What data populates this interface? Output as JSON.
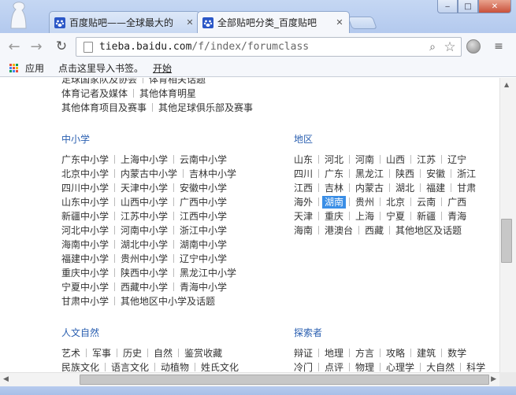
{
  "browser": {
    "tabs": [
      {
        "title": "百度贴吧——全球最大的",
        "active": false
      },
      {
        "title": "全部贴吧分类_百度贴吧",
        "active": true
      }
    ],
    "window_controls": {
      "minimize": "‒",
      "maximize": "□",
      "close": "✕"
    },
    "url": {
      "host": "tieba.baidu.com",
      "path": "/f/index/forumclass"
    },
    "bookmarks_bar": {
      "apps_label": "应用",
      "prompt": "点击这里导入书签。",
      "link": "开始"
    },
    "icons": [
      "back-arrow-icon",
      "forward-arrow-icon",
      "reload-icon",
      "page-icon",
      "search-icon",
      "star-icon",
      "globe-icon",
      "menu-icon",
      "apps-grid-icon",
      "paw-favicon"
    ],
    "colors": {
      "frame": "#b9cdef",
      "link_heading": "#2a5fb0",
      "highlight": "#3a8ee6"
    }
  },
  "content": {
    "top_rows": [
      [
        "足球国家队及协会",
        "体育相关话题"
      ],
      [
        "体育记者及媒体",
        "其他体育明星"
      ],
      [
        "其他体育项目及赛事",
        "其他足球俱乐部及赛事"
      ]
    ],
    "sections": [
      {
        "heading": "中小学",
        "rows": [
          [
            "广东中小学",
            "上海中小学",
            "云南中小学"
          ],
          [
            "北京中小学",
            "内蒙古中小学",
            "吉林中小学"
          ],
          [
            "四川中小学",
            "天津中小学",
            "安徽中小学"
          ],
          [
            "山东中小学",
            "山西中小学",
            "广西中小学"
          ],
          [
            "新疆中小学",
            "江苏中小学",
            "江西中小学"
          ],
          [
            "河北中小学",
            "河南中小学",
            "浙江中小学"
          ],
          [
            "海南中小学",
            "湖北中小学",
            "湖南中小学"
          ],
          [
            "福建中小学",
            "贵州中小学",
            "辽宁中小学"
          ],
          [
            "重庆中小学",
            "陕西中小学",
            "黑龙江中小学"
          ],
          [
            "宁夏中小学",
            "西藏中小学",
            "青海中小学"
          ],
          [
            "甘肃中小学",
            "其他地区中小学及话题"
          ]
        ]
      },
      {
        "heading": "地区",
        "highlighted": "湖南",
        "rows": [
          [
            "山东",
            "河北",
            "河南",
            "山西",
            "江苏",
            "辽宁"
          ],
          [
            "四川",
            "广东",
            "黑龙江",
            "陕西",
            "安徽",
            "浙江"
          ],
          [
            "江西",
            "吉林",
            "内蒙古",
            "湖北",
            "福建",
            "甘肃"
          ],
          [
            "海外",
            "湖南",
            "贵州",
            "北京",
            "云南",
            "广西"
          ],
          [
            "天津",
            "重庆",
            "上海",
            "宁夏",
            "新疆",
            "青海"
          ],
          [
            "海南",
            "港澳台",
            "西藏",
            "其他地区及话题"
          ]
        ]
      },
      {
        "heading": "人文自然",
        "rows": [
          [
            "艺术",
            "军事",
            "历史",
            "自然",
            "鉴赏收藏"
          ],
          [
            "民族文化",
            "语言文化",
            "动植物",
            "姓氏文化"
          ]
        ]
      },
      {
        "heading": "探索者",
        "rows": [
          [
            "辩证",
            "地理",
            "方言",
            "攻略",
            "建筑",
            "数学"
          ],
          [
            "冷门",
            "点评",
            "物理",
            "心理学",
            "大自然",
            "科学"
          ]
        ]
      }
    ]
  }
}
